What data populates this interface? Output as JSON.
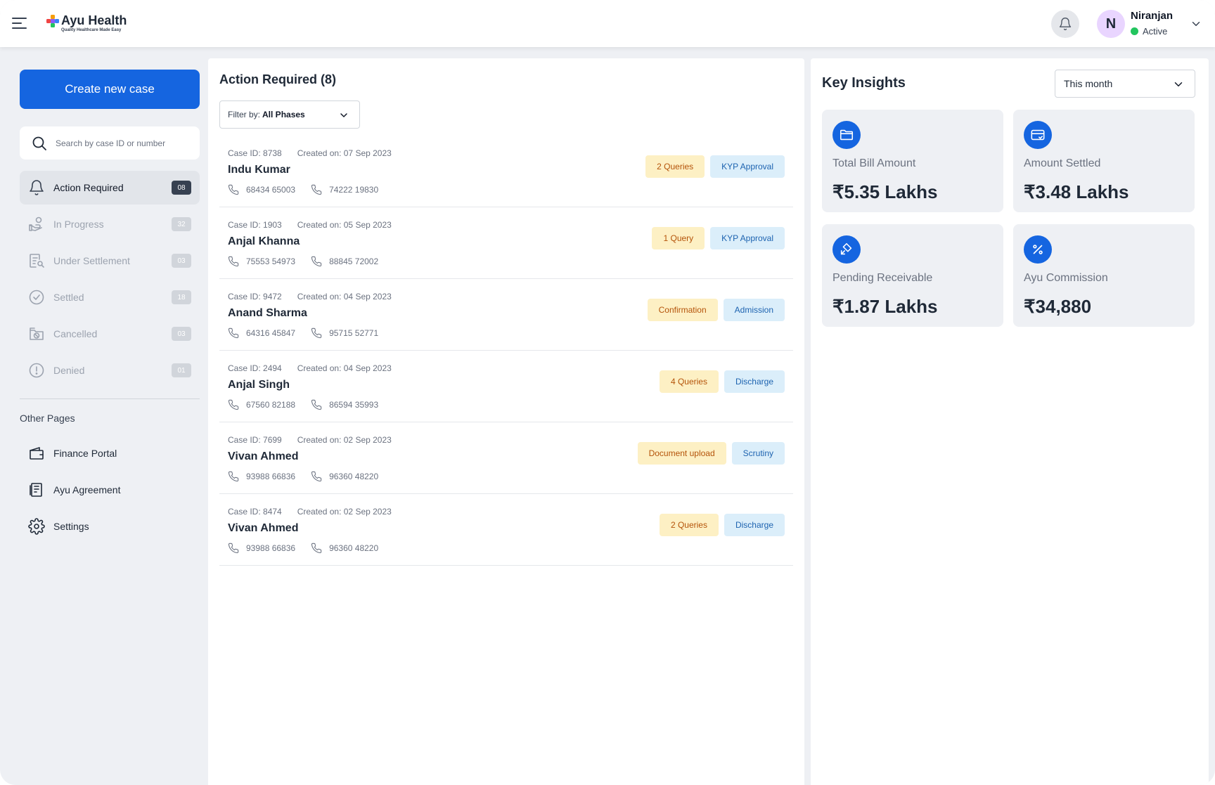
{
  "header": {
    "brand_name": "Ayu Health",
    "brand_tagline": "Quality Healthcare Made Easy",
    "user": {
      "initial": "N",
      "name": "Niranjan",
      "status": "Active"
    }
  },
  "sidebar": {
    "create_label": "Create new case",
    "search_placeholder": "Search by case ID or number",
    "items": [
      {
        "label": "Action Required",
        "count": "08",
        "icon": "bell-icon",
        "active": true
      },
      {
        "label": "In Progress",
        "count": "32",
        "icon": "hand-coin-icon",
        "active": false
      },
      {
        "label": "Under Settlement",
        "count": "03",
        "icon": "document-search-icon",
        "active": false
      },
      {
        "label": "Settled",
        "count": "18",
        "icon": "check-circle-icon",
        "active": false
      },
      {
        "label": "Cancelled",
        "count": "03",
        "icon": "cancelled-icon",
        "active": false
      },
      {
        "label": "Denied",
        "count": "01",
        "icon": "alert-circle-icon",
        "active": false
      }
    ],
    "other_title": "Other Pages",
    "other_items": [
      {
        "label": "Finance Portal",
        "icon": "wallet-icon"
      },
      {
        "label": "Ayu Agreement",
        "icon": "agreement-icon"
      },
      {
        "label": "Settings",
        "icon": "gear-icon"
      }
    ]
  },
  "main": {
    "title": "Action Required (8)",
    "filter_prefix": "Filter by:",
    "filter_value": "All Phases",
    "cases": [
      {
        "case_id": "Case ID: 8738",
        "created": "Created on: 07 Sep 2023",
        "name": "Indu Kumar",
        "phone1": "68434 65003",
        "phone2": "74222 19830",
        "tags": [
          "2 Queries",
          "KYP Approval"
        ]
      },
      {
        "case_id": "Case ID: 1903",
        "created": "Created on: 05 Sep 2023",
        "name": "Anjal Khanna",
        "phone1": "75553 54973",
        "phone2": "88845 72002",
        "tags": [
          "1 Query",
          "KYP Approval"
        ]
      },
      {
        "case_id": "Case ID: 9472",
        "created": "Created on: 04 Sep 2023",
        "name": "Anand Sharma",
        "phone1": "64316 45847",
        "phone2": "95715 52771",
        "tags": [
          "Confirmation",
          "Admission"
        ]
      },
      {
        "case_id": "Case ID: 2494",
        "created": "Created on: 04 Sep 2023",
        "name": "Anjal Singh",
        "phone1": "67560 82188",
        "phone2": "86594 35993",
        "tags": [
          "4 Queries",
          "Discharge"
        ]
      },
      {
        "case_id": "Case ID: 7699",
        "created": "Created on: 02 Sep 2023",
        "name": "Vivan Ahmed",
        "phone1": "93988 66836",
        "phone2": "96360 48220",
        "tags": [
          "Document upload",
          "Scrutiny"
        ]
      },
      {
        "case_id": "Case ID: 8474",
        "created": "Created on: 02 Sep 2023",
        "name": "Vivan Ahmed",
        "phone1": "93988 66836",
        "phone2": "96360 48220",
        "tags": [
          "2 Queries",
          "Discharge"
        ]
      }
    ]
  },
  "insights": {
    "title": "Key Insights",
    "period": "This month",
    "cards": [
      {
        "label": "Total Bill Amount",
        "value": "₹5.35 Lakhs",
        "icon": "folder-icon"
      },
      {
        "label": "Amount Settled",
        "value": "₹3.48 Lakhs",
        "icon": "card-check-icon"
      },
      {
        "label": "Pending Receivable",
        "value": "₹1.87 Lakhs",
        "icon": "receive-icon"
      },
      {
        "label": "Ayu Commission",
        "value": "₹34,880",
        "icon": "percent-icon"
      }
    ]
  },
  "colors": {
    "primary": "#1565e0",
    "warning_tag_bg": "#fdf0c4",
    "warning_tag_text": "#b45309",
    "info_tag_bg": "#dbeefa",
    "info_tag_text": "#1d63b0",
    "status_active": "#22c55e"
  }
}
